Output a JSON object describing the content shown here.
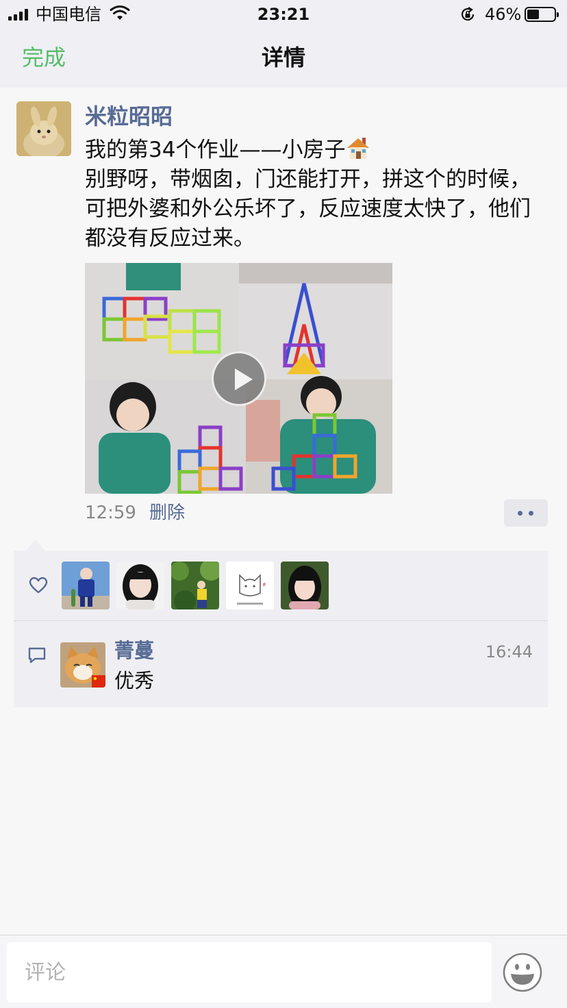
{
  "status_bar": {
    "carrier": "中国电信",
    "time": "23:21",
    "battery": "46%",
    "battery_level": 0.46,
    "icons": [
      "signal-icon",
      "wifi-icon",
      "rotation-lock-icon",
      "battery-icon"
    ]
  },
  "nav": {
    "done_label": "完成",
    "title": "详情"
  },
  "post": {
    "author": "米粒昭昭",
    "text_line1": "我的第34个作业——小房子",
    "text_rest": "别野呀，带烟囱，门还能打开，拼这个的时候，可把外婆和外公乐坏了，反应速度太快了，他们都没有反应过来。",
    "emoji": "house-emoji-icon",
    "time": "12:59",
    "delete_label": "删除",
    "media": "video",
    "icons": [
      "play-icon",
      "more-icon"
    ]
  },
  "likes": {
    "icon": "heart-icon",
    "count": 5
  },
  "comments": [
    {
      "author": "菁蔓",
      "text": "优秀",
      "time": "16:44"
    }
  ],
  "input": {
    "placeholder": "评论",
    "emoji_icon": "smiley-icon"
  },
  "colors": {
    "accent_green": "#57be6a",
    "link_blue": "#576b95",
    "panel_bg": "#efeff3",
    "nav_bg": "#efeff4"
  }
}
